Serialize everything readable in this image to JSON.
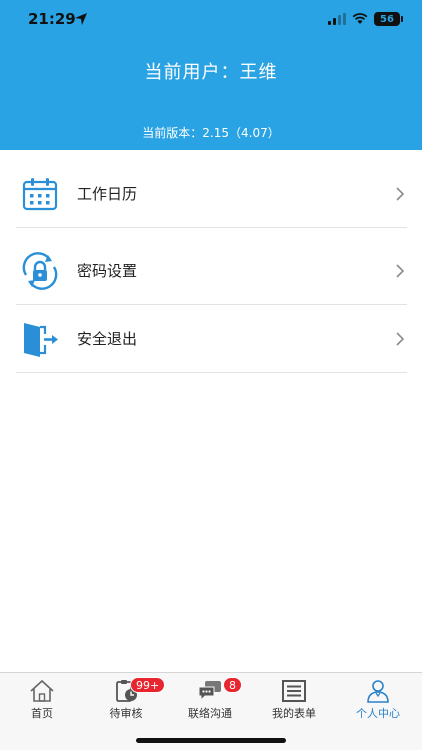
{
  "status": {
    "time": "21:29",
    "battery": "56"
  },
  "header": {
    "user_label": "当前用户：",
    "user_name": "王维",
    "version_label": "当前版本：",
    "version_value": "2.15（4.07）"
  },
  "menu": {
    "items": [
      {
        "label": "工作日历",
        "icon": "calendar-icon"
      },
      {
        "label": "密码设置",
        "icon": "lock-refresh-icon"
      },
      {
        "label": "安全退出",
        "icon": "logout-door-icon"
      }
    ]
  },
  "tabbar": {
    "items": [
      {
        "label": "首页",
        "icon": "home-icon",
        "badge": ""
      },
      {
        "label": "待审核",
        "icon": "clipboard-clock-icon",
        "badge": "99+"
      },
      {
        "label": "联络沟通",
        "icon": "chat-bubbles-icon",
        "badge": "8"
      },
      {
        "label": "我的表单",
        "icon": "form-list-icon",
        "badge": ""
      },
      {
        "label": "个人中心",
        "icon": "user-profile-icon",
        "badge": ""
      }
    ],
    "active_index": 4
  },
  "colors": {
    "header_bg": "#29a3e3",
    "icon_blue": "#2a8fd6",
    "active_tab": "#2a82c9",
    "badge_red": "#e8262f"
  }
}
